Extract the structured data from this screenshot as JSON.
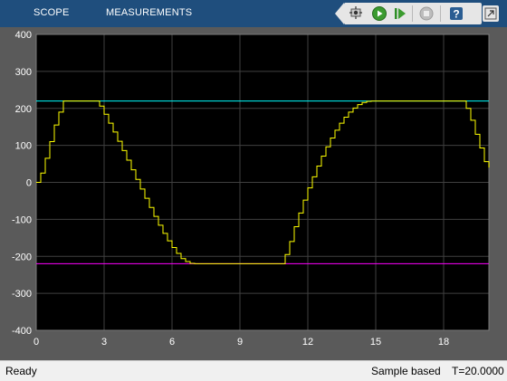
{
  "header": {
    "tabs": [
      {
        "label": "SCOPE"
      },
      {
        "label": "MEASUREMENTS"
      }
    ],
    "toolbar_icons": [
      "highlight-simulink-block-icon",
      "run-icon",
      "step-forward-icon",
      "stop-icon",
      "help-icon",
      "undock-icon"
    ]
  },
  "status": {
    "state": "Ready",
    "mode": "Sample based",
    "time": "T=20.0000"
  },
  "colors": {
    "plot_bg": "#000000",
    "grid": "#404040",
    "axes_text": "#ffffff",
    "yellow_signal": "#ffff00",
    "cyan_signal": "#00ffff",
    "magenta_signal": "#ff00ff"
  },
  "chart_data": {
    "type": "line",
    "xlim": [
      0,
      20
    ],
    "ylim": [
      -400,
      400
    ],
    "x_ticks": [
      0,
      3,
      6,
      9,
      12,
      15,
      18
    ],
    "x_tick_labels": [
      "0",
      "3",
      "6",
      "9",
      "12",
      "15",
      "18"
    ],
    "y_ticks": [
      400,
      300,
      200,
      100,
      0,
      -100,
      -200,
      -300,
      -400
    ],
    "y_tick_labels": [
      "400",
      "300",
      "200",
      "100",
      "0",
      "-100",
      "-200",
      "-300",
      "-400"
    ],
    "grid": true,
    "series": [
      {
        "color": "#00ffff",
        "x": [
          0,
          20
        ],
        "values": [
          220,
          220
        ]
      },
      {
        "color": "#ff00ff",
        "x": [
          0,
          20
        ],
        "values": [
          -220,
          -220
        ]
      },
      {
        "color": "#ffff00",
        "x": [
          0,
          0.2,
          0.4,
          0.6,
          0.8,
          1.0,
          1.2,
          2.6,
          2.8,
          3.0,
          3.2,
          3.4,
          3.6,
          3.8,
          4.0,
          4.2,
          4.4,
          4.6,
          4.8,
          5.0,
          5.2,
          5.4,
          5.6,
          5.8,
          6.0,
          6.2,
          6.4,
          6.6,
          6.8,
          7.0,
          10.8,
          11.0,
          11.2,
          11.4,
          11.6,
          11.8,
          12.0,
          12.2,
          12.4,
          12.6,
          12.8,
          13.0,
          13.2,
          13.4,
          13.6,
          13.8,
          14.0,
          14.2,
          14.4,
          14.6,
          14.8,
          15.0,
          18.8,
          19.0,
          19.2,
          19.4,
          19.6,
          19.8,
          20.0
        ],
        "values": [
          0,
          25,
          65,
          110,
          155,
          190,
          220,
          220,
          206,
          184,
          160,
          136,
          111,
          86,
          60,
          34,
          8,
          -18,
          -43,
          -68,
          -92,
          -116,
          -138,
          -158,
          -176,
          -192,
          -206,
          -214,
          -219,
          -220,
          -220,
          -195,
          -160,
          -120,
          -83,
          -48,
          -15,
          15,
          44,
          71,
          96,
          120,
          141,
          160,
          176,
          190,
          201,
          210,
          216,
          219,
          220,
          220,
          220,
          200,
          168,
          130,
          93,
          56,
          40
        ]
      }
    ]
  }
}
